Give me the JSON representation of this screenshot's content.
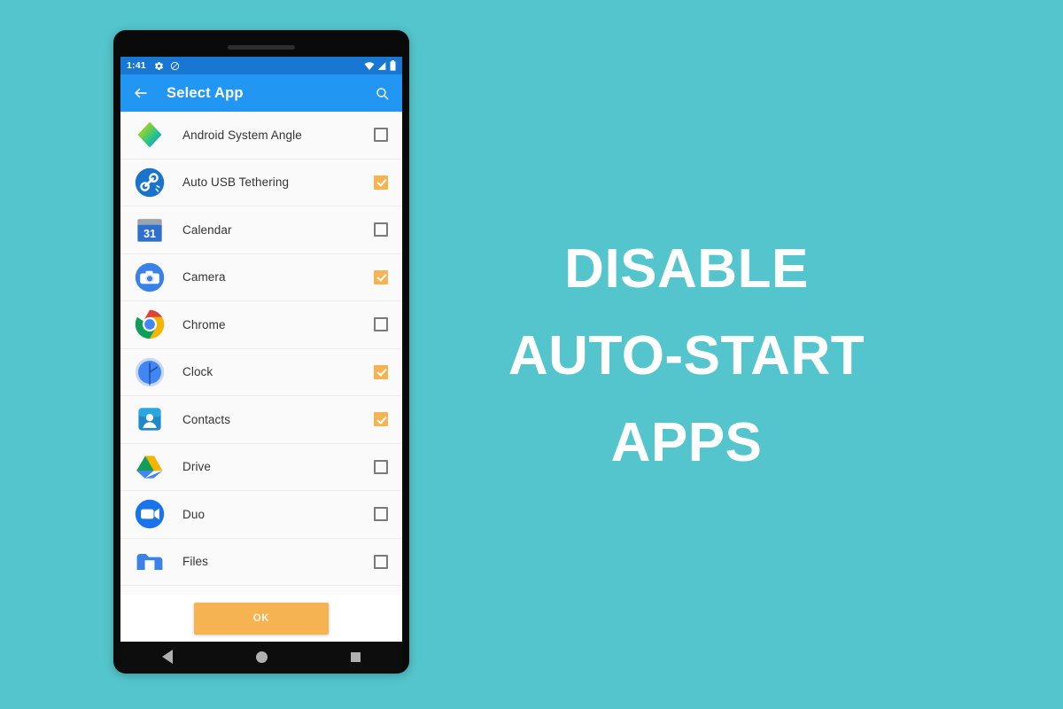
{
  "background_color": "#54c5cc",
  "headline": {
    "line1": "DISABLE",
    "line2": "AUTO-START",
    "line3": "APPS",
    "color": "#ffffff"
  },
  "phone": {
    "status_bar": {
      "time": "1:41",
      "left_icons": [
        "gear-icon",
        "do-not-disturb-icon"
      ],
      "right_icons": [
        "wifi-icon",
        "cell-signal-icon",
        "battery-icon"
      ],
      "background_color": "#1877d2"
    },
    "app_bar": {
      "back_label": "back-arrow",
      "title": "Select App",
      "search_label": "search",
      "background_color": "#2196f3"
    },
    "app_list": [
      {
        "name": "Android System Angle",
        "icon": "angle-icon",
        "checked": false
      },
      {
        "name": "Auto USB Tethering",
        "icon": "usb-tethering-icon",
        "checked": true
      },
      {
        "name": "Calendar",
        "icon": "calendar-icon",
        "checked": false
      },
      {
        "name": "Camera",
        "icon": "camera-icon",
        "checked": true
      },
      {
        "name": "Chrome",
        "icon": "chrome-icon",
        "checked": false
      },
      {
        "name": "Clock",
        "icon": "clock-icon",
        "checked": true
      },
      {
        "name": "Contacts",
        "icon": "contacts-icon",
        "checked": true
      },
      {
        "name": "Drive",
        "icon": "drive-icon",
        "checked": false
      },
      {
        "name": "Duo",
        "icon": "duo-icon",
        "checked": false
      },
      {
        "name": "Files",
        "icon": "files-icon",
        "checked": false
      }
    ],
    "footer": {
      "ok_label": "OK",
      "ok_color": "#f6b352"
    },
    "nav_bar": {
      "back": "back-triangle",
      "home": "home-circle",
      "recents": "recents-square"
    }
  },
  "colors": {
    "accent_orange": "#f6b352",
    "app_bar_blue": "#2196f3",
    "status_bar_blue": "#1877d2",
    "teal_background": "#54c5cc",
    "row_background": "#fafafa",
    "label_text": "#333333"
  }
}
